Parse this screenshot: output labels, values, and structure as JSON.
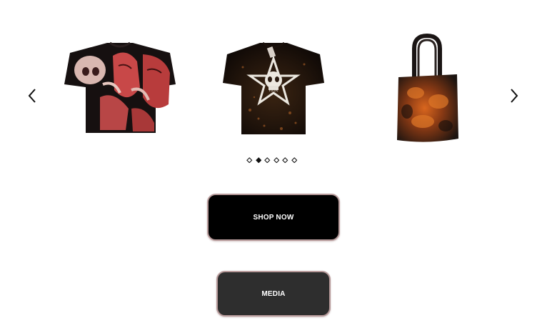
{
  "carousel": {
    "prev_icon": "chevron-left-icon",
    "next_icon": "chevron-right-icon",
    "slides": [
      {
        "icon": "graphic-tshirt-red-print"
      },
      {
        "icon": "bleached-tshirt-skull-star"
      },
      {
        "icon": "bleached-tote-bag"
      }
    ],
    "pagination": {
      "count": 6,
      "active_index": 1
    }
  },
  "buttons": {
    "shop_now_label": "SHOP NOW",
    "media_label": "MEDIA"
  },
  "colors": {
    "primary_button": "#000000",
    "secondary_button": "#2e2e2e",
    "button_border": "#b89b9b",
    "background": "#ffffff"
  }
}
